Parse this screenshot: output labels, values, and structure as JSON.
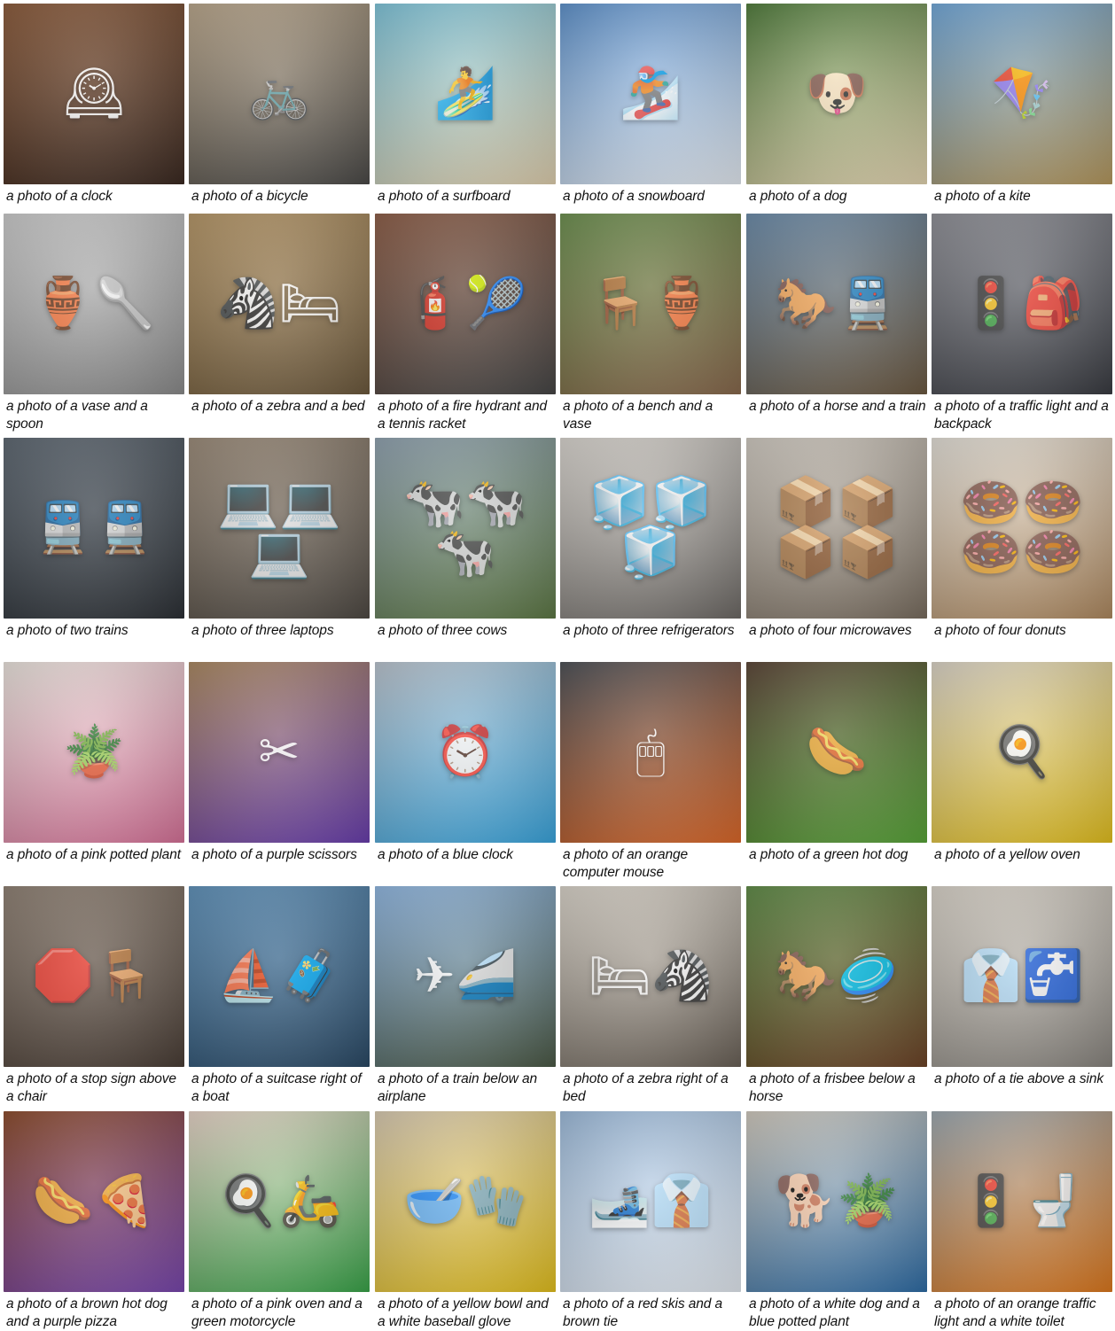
{
  "rows": [
    [
      {
        "caption": "a photo of a clock",
        "icon": "clock-icon",
        "glyph": "🕰",
        "colors": [
          "#8a5a3a",
          "#3b2a22"
        ]
      },
      {
        "caption": "a photo of a bicycle",
        "icon": "bicycle-icon",
        "glyph": "🚲",
        "colors": [
          "#b8a58a",
          "#4b4a48"
        ]
      },
      {
        "caption": "a photo of a surfboard",
        "icon": "surfboard-icon",
        "glyph": "🏄",
        "colors": [
          "#7cc2d8",
          "#e3d2b0"
        ]
      },
      {
        "caption": "a photo of a snowboard",
        "icon": "snowboard-icon",
        "glyph": "🏂",
        "colors": [
          "#5b8fc9",
          "#e8eef5"
        ]
      },
      {
        "caption": "a photo of a dog",
        "icon": "dog-icon",
        "glyph": "🐶",
        "colors": [
          "#4e7a3a",
          "#e7d8b4"
        ]
      },
      {
        "caption": "a photo of a kite",
        "icon": "kite-icon",
        "glyph": "🪁",
        "colors": [
          "#6fa6d8",
          "#b89a5e"
        ]
      }
    ],
    [
      {
        "caption": "a photo of a vase and a spoon",
        "icon": "vase-spoon-icon",
        "glyph": "🏺🥄",
        "colors": [
          "#c9c9c9",
          "#8c8c8c"
        ]
      },
      {
        "caption": "a photo of a zebra and a bed",
        "icon": "zebra-bed-icon",
        "glyph": "🦓🛏",
        "colors": [
          "#b49566",
          "#6d5a3e"
        ]
      },
      {
        "caption": "a photo of a fire hydrant and a tennis racket",
        "icon": "hydrant-racket-icon",
        "glyph": "🧯🎾",
        "colors": [
          "#8b5c46",
          "#474747"
        ]
      },
      {
        "caption": "a photo of a bench and a vase",
        "icon": "bench-vase-icon",
        "glyph": "🪑🏺",
        "colors": [
          "#6b8e4e",
          "#8a6a4e"
        ]
      },
      {
        "caption": "a photo of a horse and a train",
        "icon": "horse-train-icon",
        "glyph": "🐎🚆",
        "colors": [
          "#6a8aa8",
          "#6d5a42"
        ]
      },
      {
        "caption": "a photo of a traffic light and a backpack",
        "icon": "traffic-light-backpack-icon",
        "glyph": "🚦🎒",
        "colors": [
          "#8e8f96",
          "#3a3c42"
        ]
      }
    ],
    [
      {
        "caption": "a photo of two trains",
        "icon": "two-trains-icon",
        "glyph": "🚆🚆",
        "colors": [
          "#5c6670",
          "#2d3136"
        ]
      },
      {
        "caption": "a photo of three laptops",
        "icon": "three-laptops-icon",
        "glyph": "💻💻💻",
        "colors": [
          "#9a8a78",
          "#4f4a44"
        ]
      },
      {
        "caption": "a photo of three cows",
        "icon": "three-cows-icon",
        "glyph": "🐄🐄🐄",
        "colors": [
          "#8ea0ae",
          "#5f7a46"
        ]
      },
      {
        "caption": "a photo of three refrigerators",
        "icon": "three-refrigerators-icon",
        "glyph": "🧊🧊🧊",
        "colors": [
          "#d8d4ce",
          "#6e6a66"
        ]
      },
      {
        "caption": "a photo of four microwaves",
        "icon": "four-microwaves-icon",
        "glyph": "📦📦📦📦",
        "colors": [
          "#cfc9c0",
          "#7a6e60"
        ]
      },
      {
        "caption": "a photo of four donuts",
        "icon": "four-donuts-icon",
        "glyph": "🍩🍩🍩🍩",
        "colors": [
          "#e2ded6",
          "#b08a60"
        ]
      }
    ],
    [
      {
        "caption": "a photo of a pink potted plant",
        "icon": "pink-potted-plant-icon",
        "glyph": "🪴",
        "colors": [
          "#e9e3dc",
          "#d9739a"
        ]
      },
      {
        "caption": "a photo of a purple scissors",
        "icon": "purple-scissors-icon",
        "glyph": "✂",
        "colors": [
          "#a8865e",
          "#6a3fb0"
        ]
      },
      {
        "caption": "a photo of a blue clock",
        "icon": "blue-clock-icon",
        "glyph": "⏰",
        "colors": [
          "#b9c2cc",
          "#3aa7e0"
        ]
      },
      {
        "caption": "a photo of an orange computer mouse",
        "icon": "orange-mouse-icon",
        "glyph": "🖱",
        "colors": [
          "#4a4e54",
          "#e06a2a"
        ]
      },
      {
        "caption": "a photo of a green hot dog",
        "icon": "green-hot-dog-icon",
        "glyph": "🌭",
        "colors": [
          "#5a4436",
          "#5aa83a"
        ]
      },
      {
        "caption": "a photo of a yellow oven",
        "icon": "yellow-oven-icon",
        "glyph": "🍳",
        "colors": [
          "#d9d2c6",
          "#e6c21e"
        ]
      }
    ],
    [
      {
        "caption": "a photo of a stop sign above a chair",
        "icon": "stop-sign-chair-icon",
        "glyph": "🛑🪑",
        "colors": [
          "#8d7f72",
          "#4a3e36"
        ]
      },
      {
        "caption": "a photo of a suitcase right of a boat",
        "icon": "suitcase-boat-icon",
        "glyph": "⛵🧳",
        "colors": [
          "#5e90b8",
          "#2b4a66"
        ]
      },
      {
        "caption": "a photo of a train below an airplane",
        "icon": "train-airplane-icon",
        "glyph": "✈🚄",
        "colors": [
          "#8fb6e0",
          "#4c5a46"
        ]
      },
      {
        "caption": "a photo of a zebra right of a bed",
        "icon": "zebra-bed-right-icon",
        "glyph": "🛏🦓",
        "colors": [
          "#d8d2c8",
          "#6b6258"
        ]
      },
      {
        "caption": "a photo of a frisbee below a horse",
        "icon": "frisbee-horse-icon",
        "glyph": "🐎🥏",
        "colors": [
          "#5e8a46",
          "#6e4428"
        ]
      },
      {
        "caption": "a photo of a tie above a sink",
        "icon": "tie-sink-icon",
        "glyph": "👔🚰",
        "colors": [
          "#d8d2c8",
          "#8a8680"
        ]
      }
    ],
    [
      {
        "caption": "a photo of a brown hot dog and a purple pizza",
        "icon": "hot-dog-pizza-icon",
        "glyph": "🌭🍕",
        "colors": [
          "#8a4a2a",
          "#7a48b0"
        ]
      },
      {
        "caption": "a photo of a pink oven and a green motorcycle",
        "icon": "oven-motorcycle-icon",
        "glyph": "🍳🛵",
        "colors": [
          "#e6d2c6",
          "#3aa64a"
        ]
      },
      {
        "caption": "a photo of a yellow bowl and a white baseball glove",
        "icon": "bowl-glove-icon",
        "glyph": "🥣🧤",
        "colors": [
          "#d6c8b0",
          "#e6c21e"
        ]
      },
      {
        "caption": "a photo of a red skis and a brown tie",
        "icon": "skis-tie-icon",
        "glyph": "🎿👔",
        "colors": [
          "#9ab8d8",
          "#e8eef5"
        ]
      },
      {
        "caption": "a photo of a white dog and a blue potted plant",
        "icon": "dog-plant-icon",
        "glyph": "🐕🪴",
        "colors": [
          "#cfc8bc",
          "#2f6ea8"
        ]
      },
      {
        "caption": "a photo of an orange traffic light and a white toilet",
        "icon": "traffic-light-toilet-icon",
        "glyph": "🚦🚽",
        "colors": [
          "#9aa6ae",
          "#e07a1e"
        ]
      }
    ]
  ]
}
